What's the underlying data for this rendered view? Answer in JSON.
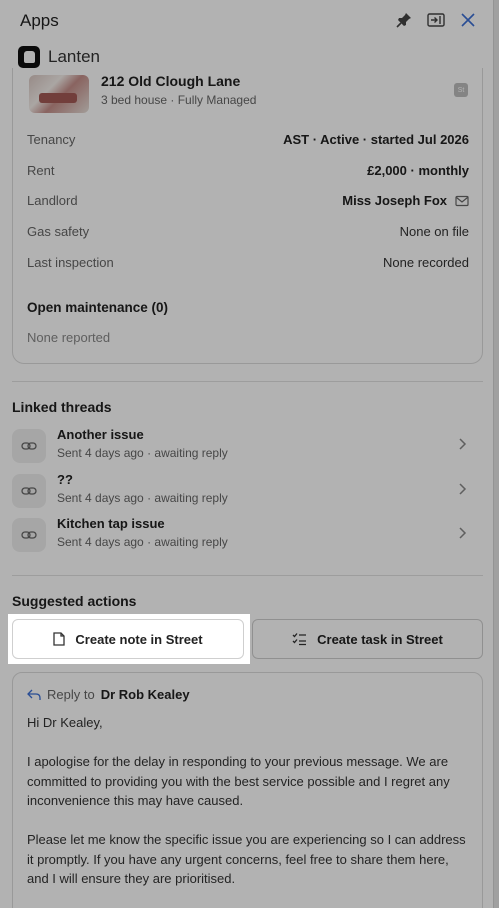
{
  "topbar": {
    "title": "Apps",
    "icons": [
      "pin-icon",
      "expand-panel-icon",
      "close-icon"
    ]
  },
  "app": {
    "name": "Lanten"
  },
  "property": {
    "address": "212 Old Clough Lane",
    "subtitle": "3 bed house · Fully Managed",
    "details": [
      {
        "key": "Tenancy",
        "value": "AST · Active · started Jul 2026",
        "strong": true
      },
      {
        "key": "Rent",
        "value": "£2,000 · monthly",
        "strong": true
      },
      {
        "key": "Landlord",
        "value": "Miss Joseph Fox",
        "strong": true,
        "icon": "mail-icon"
      },
      {
        "key": "Gas safety",
        "value": "None on file",
        "strong": false
      },
      {
        "key": "Last inspection",
        "value": "None recorded",
        "strong": false
      }
    ],
    "maintenance_title": "Open maintenance (0)",
    "maintenance_empty": "None reported"
  },
  "linked_threads": {
    "title": "Linked threads",
    "items": [
      {
        "name": "Another issue",
        "meta": "Sent 4 days ago · awaiting reply"
      },
      {
        "name": "??",
        "meta": "Sent 4 days ago · awaiting reply"
      },
      {
        "name": "Kitchen tap issue",
        "meta": "Sent 4 days ago · awaiting reply"
      }
    ]
  },
  "suggested_actions": {
    "title": "Suggested actions",
    "note_label": "Create note in Street",
    "task_label": "Create task in Street"
  },
  "reply": {
    "prefix": "Reply to",
    "recipient": "Dr Rob Kealey",
    "greeting": "Hi Dr Kealey,",
    "para1": "I apologise for the delay in responding to your previous message. We are committed to providing you with the best service possible and I regret any inconvenience this may have caused.",
    "para2": "Please let me know the specific issue you are experiencing so I can address it promptly. If you have any urgent concerns, feel free to share them here, and I will ensure they are prioritised."
  },
  "colors": {
    "overlay": "#000000",
    "highlight": "#ffffff"
  }
}
